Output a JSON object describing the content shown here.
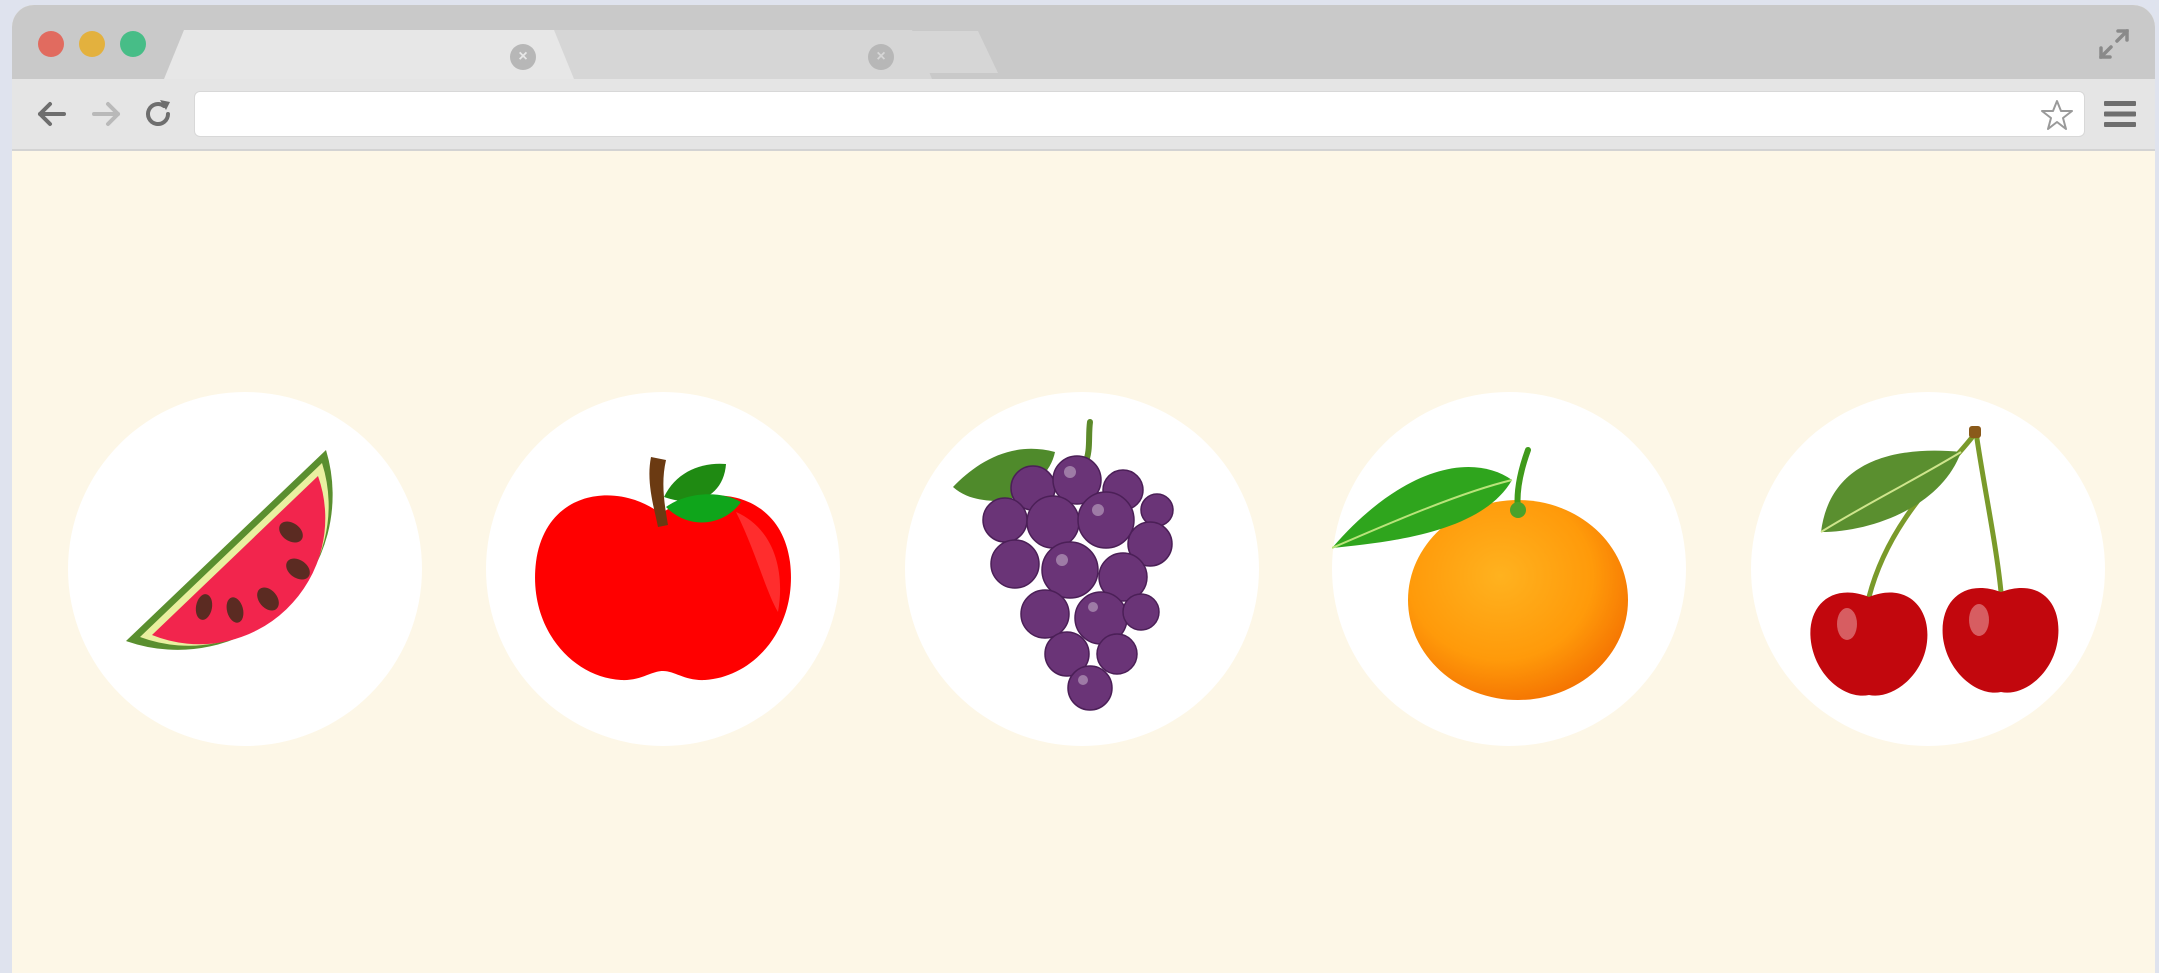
{
  "browser": {
    "tabs": [
      {
        "title": "",
        "active": true
      },
      {
        "title": "",
        "active": false
      }
    ],
    "address": {
      "value": "",
      "placeholder": ""
    },
    "colors": {
      "chrome": "#c9c9c9",
      "toolbar": "#e5e5e5",
      "page_background": "#fdf7e7"
    }
  },
  "fruits": [
    {
      "name": "watermelon",
      "icon": "watermelon-icon"
    },
    {
      "name": "apple",
      "icon": "apple-icon"
    },
    {
      "name": "grapes",
      "icon": "grapes-icon"
    },
    {
      "name": "orange",
      "icon": "orange-icon"
    },
    {
      "name": "cherries",
      "icon": "cherries-icon"
    }
  ]
}
